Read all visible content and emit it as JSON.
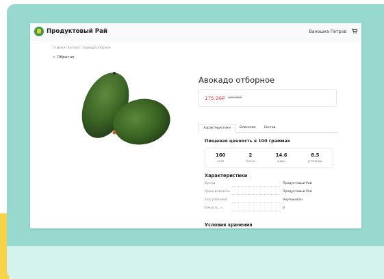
{
  "header": {
    "brand": "Продуктовый Рай",
    "user": "Ваношка Петров",
    "cart_icon": "cart-icon"
  },
  "breadcrumb": "Главная / Каталог / Авокадо отборное",
  "back_label": "Обратно",
  "product": {
    "title": "Авокадо отборное",
    "price": "175.96₽",
    "old_price": "199.96₽"
  },
  "tabs": [
    {
      "label": "Характеристики",
      "active": true
    },
    {
      "label": "Описание",
      "active": false
    },
    {
      "label": "Состав",
      "active": false
    }
  ],
  "nutrition": {
    "heading": "Пищевая ценность в 100 граммах",
    "items": [
      {
        "value": "160",
        "unit": "ккал"
      },
      {
        "value": "2",
        "unit": "белки"
      },
      {
        "value": "14.6",
        "unit": "жиры"
      },
      {
        "value": "8.5",
        "unit": "углеводы"
      }
    ]
  },
  "characteristics": {
    "heading": "Характеристики",
    "rows": [
      {
        "key": "Бренд",
        "value": "Продуктовый Рай"
      },
      {
        "key": "Производитель",
        "value": "Продуктовый Рай"
      },
      {
        "key": "Тип упаковки",
        "value": "Неупакован"
      },
      {
        "key": "Ёмкость, л",
        "value": "0"
      }
    ]
  },
  "storage_heading": "Условия хранения",
  "colors": {
    "frame": "#97d9cf",
    "footer": "#d4f3ec",
    "price": "#e84a57",
    "accent_yellow": "#f6d349"
  }
}
